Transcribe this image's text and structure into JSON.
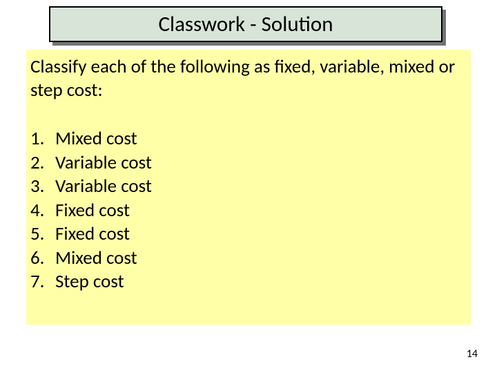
{
  "title": "Classwork - Solution",
  "instruction": "Classify each of the following as fixed, variable, mixed or step cost:",
  "items": [
    {
      "num": "1.",
      "text": "Mixed cost"
    },
    {
      "num": "2.",
      "text": "Variable cost"
    },
    {
      "num": "3.",
      "text": "Variable cost"
    },
    {
      "num": "4.",
      "text": "Fixed cost"
    },
    {
      "num": "5.",
      "text": "Fixed cost"
    },
    {
      "num": "6.",
      "text": "Mixed cost"
    },
    {
      "num": "7.",
      "text": "Step cost"
    }
  ],
  "page_number": "14"
}
